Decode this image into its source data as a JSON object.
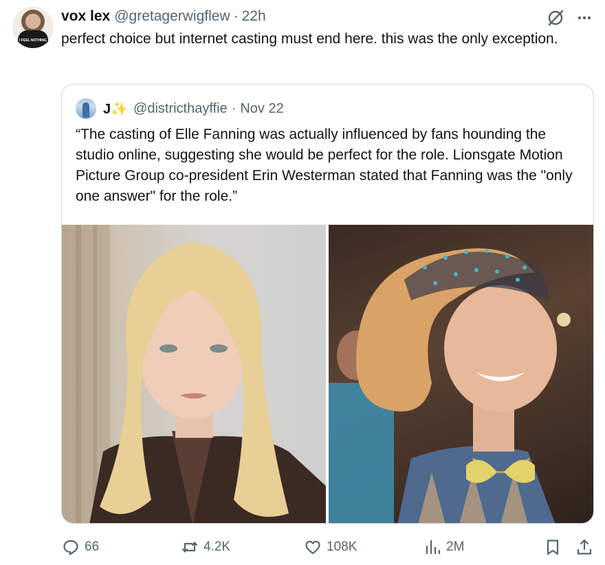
{
  "tweet": {
    "author_name": "vox lex",
    "author_handle": "@gretagerwigflew",
    "separator": "·",
    "time": "22h",
    "text": "perfect choice but internet casting must end here. this was the only exception.",
    "avatar_shirt_text": "I FEEL NOTHING"
  },
  "quote": {
    "author_name": "J✨",
    "author_handle": "@districthayffie",
    "separator": "·",
    "date": "Nov 22",
    "text": "“The casting of Elle Fanning was actually influenced by fans hounding the studio online, suggesting she would be perfect for the role. Lionsgate Motion Picture Group co-president Erin Westerman stated that Fanning was the \"only one answer\" for the role.”",
    "images": [
      {
        "subject": "portrait-blonde-woman"
      },
      {
        "subject": "smiling-woman-in-costume"
      }
    ]
  },
  "actions": {
    "replies": "66",
    "reposts": "4.2K",
    "likes": "108K",
    "views": "2M"
  },
  "icons": {
    "grok": "grok-icon",
    "more": "more-icon",
    "reply": "reply-icon",
    "repost": "repost-icon",
    "like": "heart-icon",
    "views": "views-icon",
    "bookmark": "bookmark-icon",
    "share": "share-icon"
  },
  "colors": {
    "text": "#0f1419",
    "muted": "#536471",
    "border": "#cfd9de"
  }
}
